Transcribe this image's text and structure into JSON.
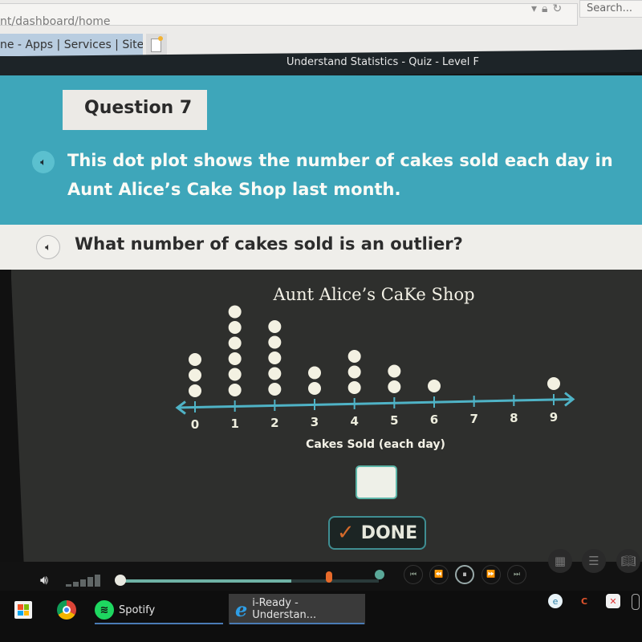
{
  "browser": {
    "url": "nt/dashboard/home",
    "search_placeholder": "Search...",
    "active_tab": "ne - Apps | Services | Sites"
  },
  "app": {
    "title": "Understand Statistics - Quiz - Level F"
  },
  "question": {
    "number_label": "Question 7",
    "prompt": "This dot plot shows the number of cakes sold each day in Aunt Alice’s Cake Shop last month.",
    "question_text": "What number of cakes sold is an outlier?",
    "answer_value": "",
    "done_label": "DONE"
  },
  "chart_data": {
    "type": "dot plot",
    "title": "Aunt Alice’s CaKe Shop",
    "xlabel": "Cakes Sold (each day)",
    "categories": [
      "0",
      "1",
      "2",
      "3",
      "4",
      "5",
      "6",
      "7",
      "8",
      "9"
    ],
    "x": [
      0,
      1,
      2,
      3,
      4,
      5,
      6,
      7,
      8,
      9
    ],
    "values": [
      3,
      6,
      5,
      2,
      3,
      2,
      1,
      0,
      0,
      1
    ],
    "xlim": [
      0,
      9
    ],
    "grid": false
  },
  "player": {
    "progress_fraction": 0.85,
    "volume_level": 0.8,
    "controls": [
      "skip-back",
      "rewind",
      "pause",
      "fast-forward",
      "skip-forward"
    ]
  },
  "taskbar": {
    "items": [
      {
        "name": "store",
        "label": ""
      },
      {
        "name": "chrome",
        "label": ""
      },
      {
        "name": "spotify",
        "label": "Spotify"
      },
      {
        "name": "ie",
        "label": "i-Ready - Understan..."
      }
    ]
  },
  "colors": {
    "banner": "#3ea6ba",
    "board": "#2e2f2d",
    "dot": "#f3f1e2",
    "axis": "#4fb3c6",
    "done_check": "#d46a2a"
  }
}
